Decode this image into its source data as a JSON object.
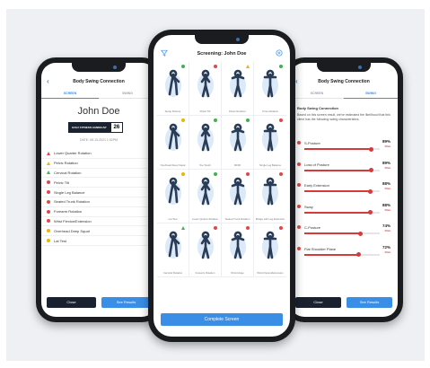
{
  "colors": {
    "accent": "#3a8ee6",
    "dark": "#1a2230",
    "red": "#e04848",
    "yellow": "#f0b400",
    "green": "#3cb44a"
  },
  "left_screen": {
    "header_title": "Body Swing Connection",
    "tabs": [
      "SCREEN",
      "SWING"
    ],
    "patient_name": "John Doe",
    "score_label": "GOLF FITNESS HANDICAP",
    "score_value": "26",
    "date": "DATE: 05-13-2021 1:02PM",
    "items": [
      {
        "label": "Lower Quarter Rotation",
        "mark": "triangle",
        "color": "#e04848"
      },
      {
        "label": "Pelvic Rotation",
        "mark": "triangle",
        "color": "#f0b400"
      },
      {
        "label": "Cervical Rotation",
        "mark": "triangle",
        "color": "#3cb44a"
      },
      {
        "label": "Pelvic Tilt",
        "mark": "dot",
        "color": "#e04848"
      },
      {
        "label": "Single Leg Balance",
        "mark": "dot",
        "color": "#e04848"
      },
      {
        "label": "Seated Trunk Rotation",
        "mark": "dot",
        "color": "#e04848"
      },
      {
        "label": "Forearm Rotation",
        "mark": "dot",
        "color": "#e04848"
      },
      {
        "label": "Wrist Flexion/Extension",
        "mark": "dot",
        "color": "#e04848"
      },
      {
        "label": "Overhead Deep Squat",
        "mark": "dot",
        "color": "#f0b400"
      },
      {
        "label": "Lat Test",
        "mark": "dot",
        "color": "#f0b400"
      }
    ],
    "close_label": "Close",
    "results_label": "See Results"
  },
  "center_screen": {
    "header_title": "Screening: John Doe",
    "filter_icon": "filter-icon",
    "add_icon": "add-icon",
    "tests": [
      {
        "caption": "Setup Posture",
        "indicator": "dot",
        "color": "#3cb44a"
      },
      {
        "caption": "Pelvic Tilt",
        "indicator": "dot",
        "color": "#e04848"
      },
      {
        "caption": "Pelvic Rotation",
        "indicator": "triangle",
        "color": "#f0b400"
      },
      {
        "caption": "Torso Rotation",
        "indicator": "dot",
        "color": "#3cb44a"
      },
      {
        "caption": "Overhead Deep Squat",
        "indicator": "dot",
        "color": "#f0b400"
      },
      {
        "caption": "Toe Touch",
        "indicator": "dot",
        "color": "#3cb44a"
      },
      {
        "caption": "90/90",
        "indicator": "dot",
        "color": "#3cb44a"
      },
      {
        "caption": "Single Leg Balance",
        "indicator": "dot",
        "color": "#e04848"
      },
      {
        "caption": "Lat Test",
        "indicator": "dot",
        "color": "#f0b400"
      },
      {
        "caption": "Lower Quarter Rotation",
        "indicator": "dot",
        "color": "#3cb44a"
      },
      {
        "caption": "Seated Trunk Rotation",
        "indicator": "dot",
        "color": "#e04848"
      },
      {
        "caption": "Bridge with Leg Extension",
        "indicator": "dot",
        "color": "#e04848"
      },
      {
        "caption": "Cervical Rotation",
        "indicator": "triangle",
        "color": "#3cb44a"
      },
      {
        "caption": "Forearm Rotation",
        "indicator": "dot",
        "color": "#e04848"
      },
      {
        "caption": "Wrist Hinge",
        "indicator": "dot",
        "color": "#e04848"
      },
      {
        "caption": "Wrist Flexion/Extension",
        "indicator": "dot",
        "color": "#e04848"
      }
    ],
    "complete_label": "Complete Screen"
  },
  "right_screen": {
    "header_title": "Body Swing Connection",
    "tabs": [
      "SCREEN",
      "SWING"
    ],
    "section_title": "Body Swing Connection",
    "description": "Based on this screen result, we've estimated the likelihood that this client has the following swing characteristics.",
    "results": [
      {
        "label": "S-Posture",
        "percent": "89%",
        "value": 89,
        "risk": "Risk"
      },
      {
        "label": "Loss of Posture",
        "percent": "89%",
        "value": 89,
        "risk": "Risk"
      },
      {
        "label": "Early Extension",
        "percent": "88%",
        "value": 88,
        "risk": "Risk"
      },
      {
        "label": "Sway",
        "percent": "88%",
        "value": 88,
        "risk": "Risk"
      },
      {
        "label": "C-Posture",
        "percent": "74%",
        "value": 74,
        "risk": "Risk"
      },
      {
        "label": "Flat Shoulder Plane",
        "percent": "72%",
        "value": 72,
        "risk": "Risk"
      }
    ],
    "close_label": "Close",
    "results_label": "See Results"
  }
}
